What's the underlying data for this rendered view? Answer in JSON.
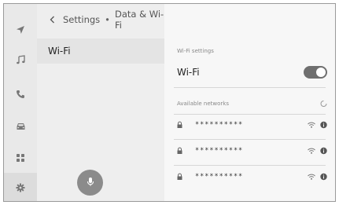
{
  "rail": {
    "items": [
      {
        "icon": "navigation-icon"
      },
      {
        "icon": "music-icon"
      },
      {
        "icon": "phone-icon"
      },
      {
        "icon": "car-icon"
      },
      {
        "icon": "apps-icon"
      },
      {
        "icon": "gear-icon",
        "active": true
      }
    ]
  },
  "header": {
    "back_icon": "chevron-left-icon",
    "breadcrumb_parent": "Settings",
    "breadcrumb_separator": "•",
    "breadcrumb_current": "Data & Wi-Fi"
  },
  "left_menu": {
    "items": [
      {
        "label": "Wi-Fi",
        "selected": true
      }
    ]
  },
  "voice": {
    "icon": "microphone-icon"
  },
  "wifi_settings": {
    "section_label": "Wi-Fi settings",
    "wifi_label": "Wi-Fi",
    "wifi_enabled": true
  },
  "available_networks": {
    "section_label": "Available networks",
    "scanning_icon": "loading-spinner-icon",
    "networks": [
      {
        "name": "**********",
        "secured": true,
        "icon_signal": "wifi-signal-icon",
        "icon_info": "info-icon"
      },
      {
        "name": "**********",
        "secured": true,
        "icon_signal": "wifi-signal-icon",
        "icon_info": "info-icon"
      },
      {
        "name": "**********",
        "secured": true,
        "icon_signal": "wifi-signal-icon",
        "icon_info": "info-icon"
      }
    ]
  },
  "colors": {
    "rail_bg": "#e9e9e9",
    "left_pane_bg": "#eeeeee",
    "right_pane_bg": "#f7f7f7",
    "toggle_on": "#6f6f6f",
    "mic_button": "#8b8b8b"
  }
}
